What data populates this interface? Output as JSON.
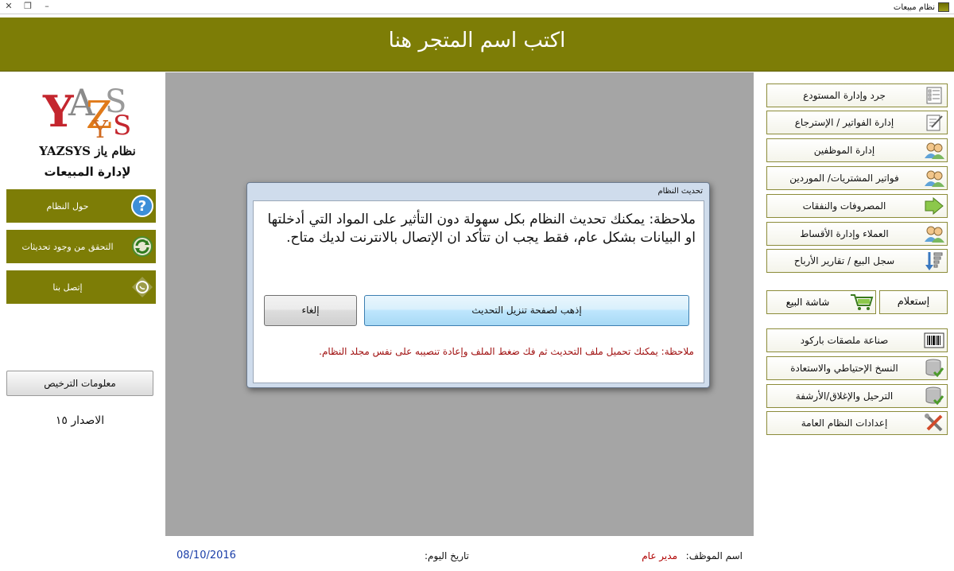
{
  "window": {
    "title": "نظام مبيعات",
    "controls": [
      "✕",
      "❐",
      "–"
    ]
  },
  "banner": {
    "title": "اكتب اسم المتجر هنا"
  },
  "brand": {
    "logo_text": "YAZSYS",
    "line1": "نظام ياز YAZSYS",
    "line2": "لإدارة المبيعات"
  },
  "left_menu": [
    {
      "label": "حول النظام",
      "icon": "help-icon"
    },
    {
      "label": "التحقق من وجود تحديثات",
      "icon": "refresh-icon"
    },
    {
      "label": "إتصل بنا",
      "icon": "whatsapp-icon"
    }
  ],
  "license_button": "معلومات الترخيص",
  "version": "الاصدار ١٥",
  "right_menu": [
    {
      "label": "جرد وإدارة المستودع",
      "icon": "inventory-icon"
    },
    {
      "label": "إدارة الفواتير / الإسترجاع",
      "icon": "invoice-icon"
    },
    {
      "label": "إدارة الموظفين",
      "icon": "users-icon"
    },
    {
      "label": "فواتير المشتريات/ الموردين",
      "icon": "users-icon"
    },
    {
      "label": "المصروفات والنفقات",
      "icon": "arrow-icon"
    },
    {
      "label": "العملاء وإدارة الأقساط",
      "icon": "users-icon"
    },
    {
      "label": "سجل البيع / تقارير الأرباح",
      "icon": "report-icon"
    }
  ],
  "query_button": "إستعلام",
  "pos_button": "شاشة البيع",
  "right_menu2": [
    {
      "label": "صناعة ملصقات باركود",
      "icon": "barcode-icon"
    },
    {
      "label": "النسخ الإحتياطي والاستعادة",
      "icon": "database-icon"
    },
    {
      "label": "الترحيل والإغلاق/الأرشفة",
      "icon": "database-icon"
    },
    {
      "label": "إعدادات النظام العامة",
      "icon": "tools-icon"
    }
  ],
  "footer": {
    "date_label": "تاريخ اليوم:",
    "date": "08/10/2016",
    "employee_label": "اسم الموظف:",
    "employee": "مدير عام"
  },
  "dialog": {
    "title": "تحديث النظام",
    "message": "ملاحظة: يمكنك تحديث النظام بكل سهولة دون التأثير على المواد التي أدخلتها او البيانات بشكل عام، فقط يجب ان تتأكد ان الإتصال بالانترنت لديك متاح.",
    "go_button": "إذهب لصفحة تنزيل التحديث",
    "cancel_button": "إلغاء",
    "note": "ملاحظة: يمكنك تحميل ملف التحديث ثم فك ضغط الملف وإعادة تنصيبه على نفس مجلد النظام."
  },
  "colors": {
    "olive": "#7d7d06",
    "center_gray": "#a5a5a5",
    "dialog_frame": "#cfdcec",
    "note_red": "#a01010",
    "date_blue": "#1a3ea8"
  }
}
